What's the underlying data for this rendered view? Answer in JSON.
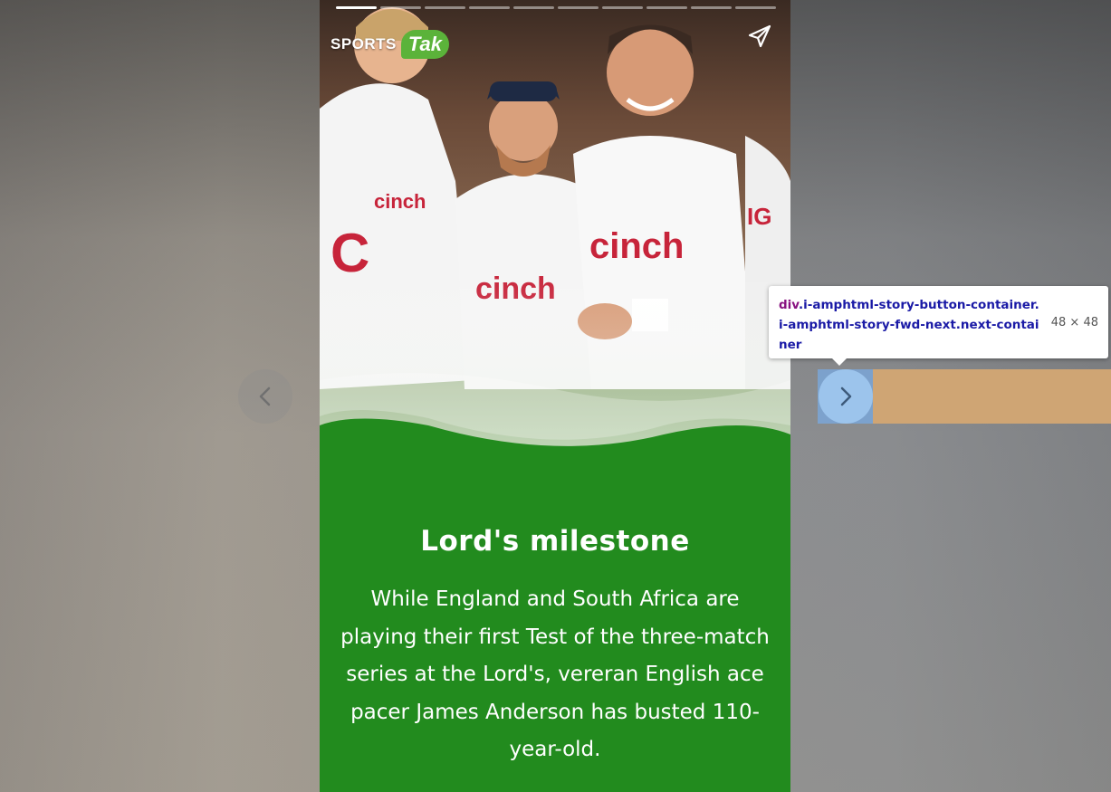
{
  "story": {
    "progress_segments": 10,
    "active_segment": 1,
    "brand": {
      "sports": "SPORTS",
      "tak": "Tak"
    },
    "title": "Lord's milestone",
    "body": "While England and South Africa are playing their first Test of the three-match series at the Lord's, vereran English ace pacer James Anderson has busted 110-year-old.",
    "accent_color": "#228b1e",
    "photo_shirt_text": "cinch",
    "share_icon": "share-icon"
  },
  "navigation": {
    "prev_icon": "chevron-left-icon",
    "next_icon": "chevron-right-icon"
  },
  "devtools_tooltip": {
    "tag": "div",
    "classes": ".i-amphtml-story-button-container.i-amphtml-story-fwd-next.next-container",
    "size": "48 × 48"
  }
}
